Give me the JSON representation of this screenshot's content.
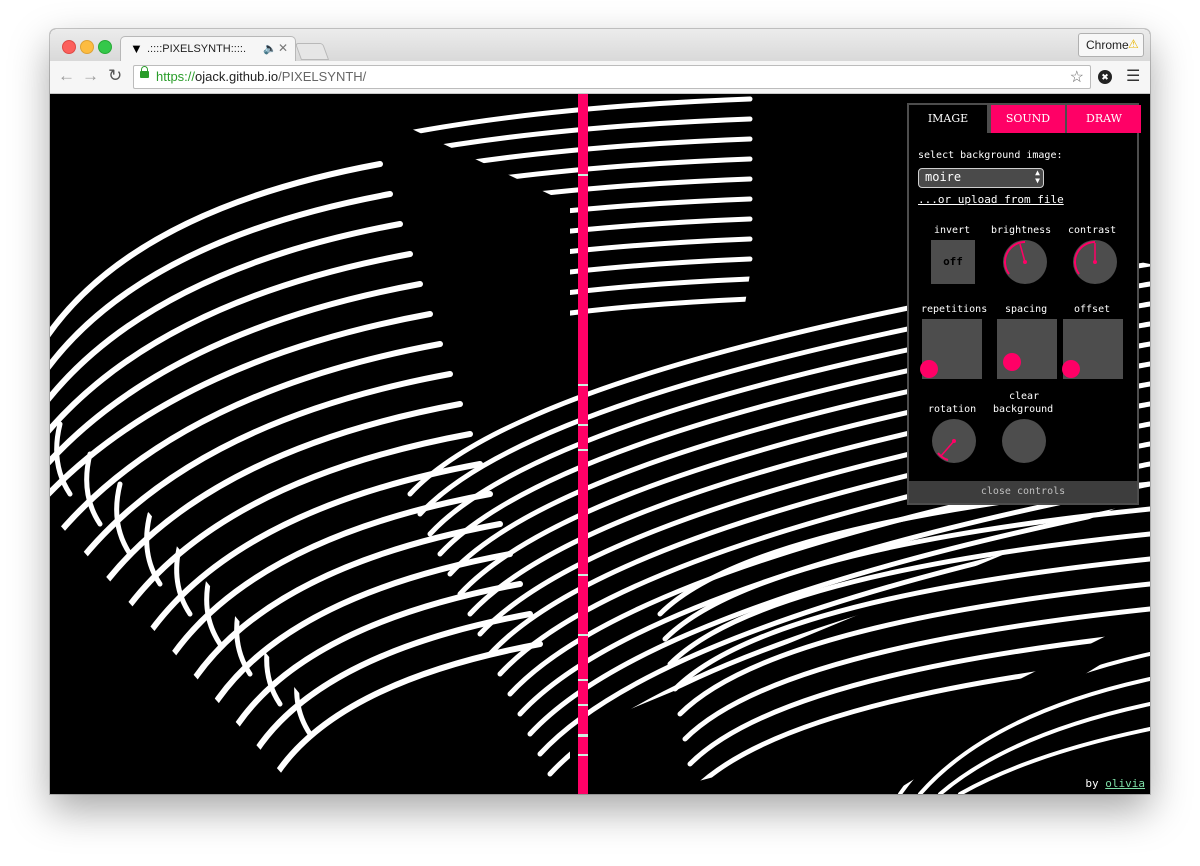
{
  "browser": {
    "tab_title": ".::::PIXELSYNTH::::.",
    "tab_favicon": "▼",
    "audio_icon": "speaker-icon",
    "profile_label": "Chrome",
    "url_scheme": "https://",
    "url_host": "ojack.github.io",
    "url_path": "/PIXELSYNTH/"
  },
  "panel": {
    "tabs": [
      "IMAGE",
      "SOUND",
      "DRAW"
    ],
    "select_label": "select background image:",
    "select_value": "moire",
    "upload_link": "...or upload from file",
    "controls": {
      "invert": {
        "label": "invert",
        "state": "off"
      },
      "brightness": {
        "label": "brightness"
      },
      "contrast": {
        "label": "contrast"
      },
      "repetitions": {
        "label": "repetitions"
      },
      "spacing": {
        "label": "spacing"
      },
      "offset": {
        "label": "offset"
      },
      "rotation": {
        "label": "rotation"
      },
      "clear_line1": "clear",
      "clear_line2": "background"
    },
    "close_label": "close controls"
  },
  "credit": {
    "prefix": "by",
    "author": "olivia"
  },
  "colors": {
    "accent": "#ff0066",
    "panel_gray": "#4d4d4d",
    "link_green": "#7ee0a8"
  }
}
